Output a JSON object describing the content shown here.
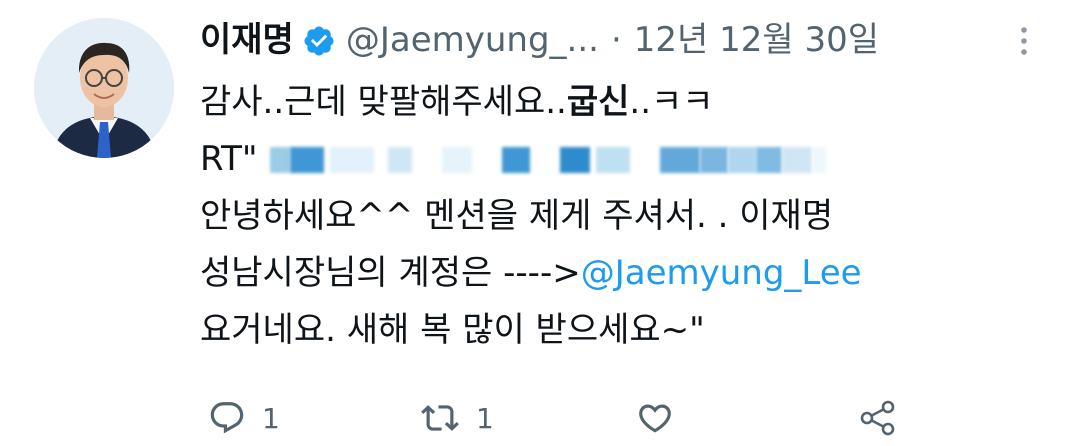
{
  "tweet": {
    "display_name": "이재명",
    "handle": "@Jaemyung_...",
    "separator": "·",
    "date": "12년 12월 30일",
    "verified_icon": "verified-badge-icon",
    "more_icon": "more-vertical-icon",
    "line1_prefix": "감사..근데 맞팔해주세요..",
    "line1_bold": "굽신",
    "line1_suffix": "..ㅋㅋ",
    "line2_prefix": "RT\"",
    "line3": "안녕하세요^^ 멘션을 제게 주셔서. . 이재명",
    "line4_prefix": "성남시장님의 계정은 ---->",
    "line4_mention": "@Jaemyung_Lee",
    "line5": "요거네요. 새해 복 많이 받으세요~\"",
    "accent_color": "#1d9bf0"
  },
  "actions": {
    "reply_count": "1",
    "retweet_count": "1",
    "reply_icon": "reply-icon",
    "retweet_icon": "retweet-icon",
    "like_icon": "heart-icon",
    "share_icon": "share-icon"
  }
}
